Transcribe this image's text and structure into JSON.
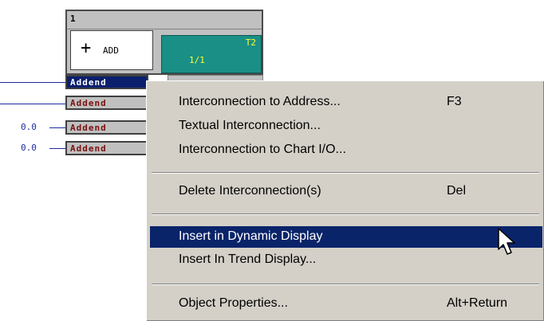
{
  "block": {
    "number": "1",
    "type_icon": "plus-icon",
    "type_label": "ADD",
    "task_id": "T2",
    "task_ratio": "1/1"
  },
  "inputs": [
    {
      "label": "Addend",
      "value": "",
      "selected": true
    },
    {
      "label": "Addend",
      "value": "",
      "selected": false
    },
    {
      "label": "Addend",
      "value": "0.0",
      "selected": false
    },
    {
      "label": "Addend",
      "value": "0.0",
      "selected": false
    }
  ],
  "context_menu": {
    "items": [
      {
        "label": "Interconnection to Address...",
        "shortcut": "F3"
      },
      {
        "label": "Textual Interconnection...",
        "shortcut": ""
      },
      {
        "label": "Interconnection to Chart I/O...",
        "shortcut": ""
      },
      {
        "label": "Delete Interconnection(s)",
        "shortcut": "Del"
      },
      {
        "label": "Insert in Dynamic Display",
        "shortcut": "",
        "highlighted": true
      },
      {
        "label": "Insert In Trend Display...",
        "shortcut": ""
      },
      {
        "label": "Object Properties...",
        "shortcut": "Alt+Return"
      }
    ]
  },
  "colors": {
    "selection": "#0a246a",
    "wire": "#1c2b9e",
    "task_bg": "#1a8f85",
    "task_text": "#ffff33",
    "pin_text": "#7a1010"
  },
  "cursor_icon": "arrow-cursor-icon"
}
